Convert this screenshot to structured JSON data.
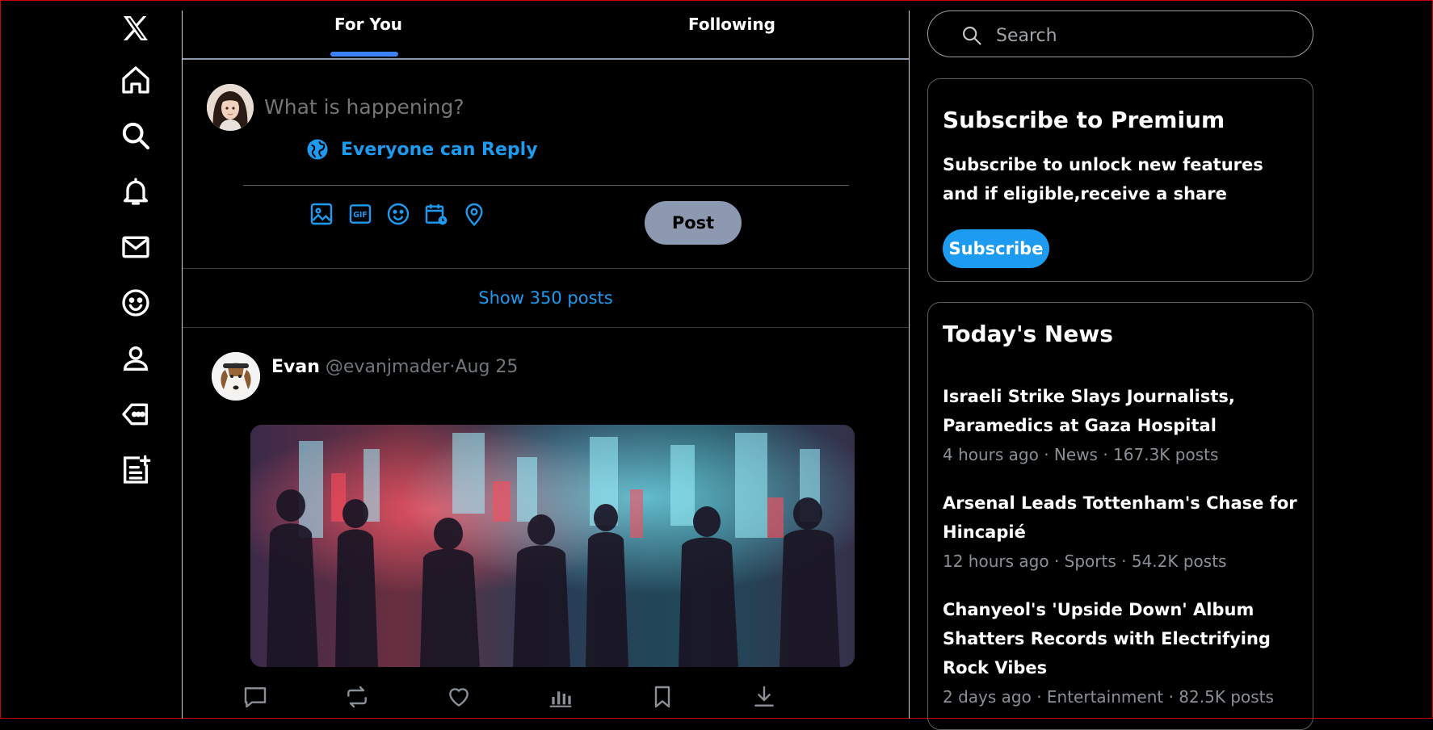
{
  "colors": {
    "accent": "#1d9bf0",
    "tab_underline": "#3b82f6",
    "post_button": "#8c99b0",
    "background": "#000000",
    "muted_text": "#71767b"
  },
  "nav": {
    "items": [
      {
        "icon": "x-logo-icon"
      },
      {
        "icon": "home-icon"
      },
      {
        "icon": "search-icon"
      },
      {
        "icon": "bell-icon"
      },
      {
        "icon": "mail-icon"
      },
      {
        "icon": "smiley-icon"
      },
      {
        "icon": "profile-icon"
      },
      {
        "icon": "tag-icon"
      },
      {
        "icon": "list-add-icon"
      }
    ]
  },
  "tabs": {
    "for_you": "For You",
    "following": "Following",
    "active": "For You"
  },
  "composer": {
    "placeholder": "What is happening?",
    "reply_setting": "Everyone can Reply",
    "tools": [
      "image-icon",
      "gif-icon",
      "emoji-icon",
      "schedule-icon",
      "location-icon"
    ],
    "post_label": "Post"
  },
  "feed": {
    "show_posts": "Show 350 posts"
  },
  "tweet": {
    "name": "Evan",
    "handle": "@evanjmader",
    "separator": "·",
    "date": "Aug 25",
    "actions": [
      "reply-icon",
      "retweet-icon",
      "like-icon",
      "views-icon",
      "bookmark-icon",
      "download-icon"
    ]
  },
  "search": {
    "placeholder": "Search"
  },
  "premium": {
    "title": "Subscribe to Premium",
    "text": "Subscribe to unlock new features and if eligible,receive a share",
    "button": "Subscribe"
  },
  "news": {
    "title": "Today's News",
    "items": [
      {
        "headline": "Israeli Strike Slays Journalists, Paramedics at Gaza Hospital",
        "meta": "4 hours ago · News · 167.3K posts"
      },
      {
        "headline": "Arsenal Leads Tottenham's Chase for Hincapié",
        "meta": "12 hours ago · Sports · 54.2K posts"
      },
      {
        "headline": "Chanyeol's 'Upside Down' Album Shatters Records with Electrifying Rock Vibes",
        "meta": "2 days ago · Entertainment · 82.5K posts"
      }
    ]
  }
}
